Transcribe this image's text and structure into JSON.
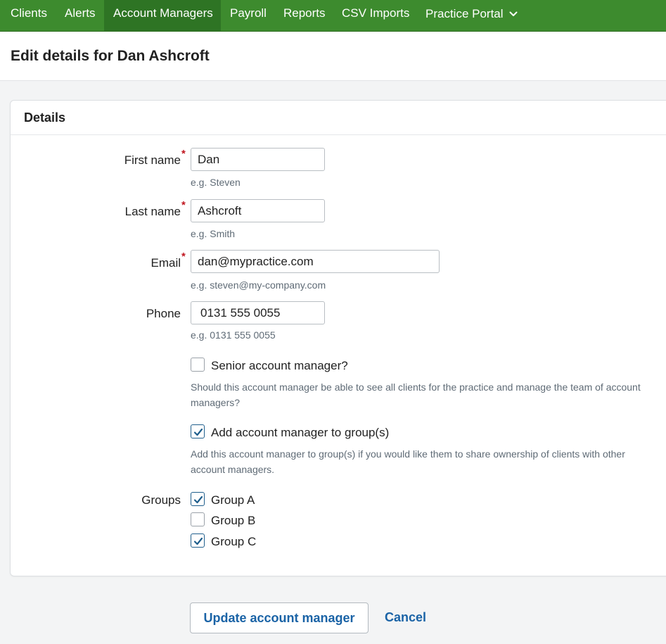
{
  "nav": {
    "items": [
      {
        "label": "Clients"
      },
      {
        "label": "Alerts"
      },
      {
        "label": "Account Managers",
        "active": true
      },
      {
        "label": "Payroll"
      },
      {
        "label": "Reports"
      },
      {
        "label": "CSV Imports"
      },
      {
        "label": "Practice Portal",
        "icon": "chevron-down-icon"
      }
    ],
    "background": "#3d8b2e"
  },
  "page": {
    "title": "Edit details for Dan Ashcroft"
  },
  "card": {
    "title": "Details"
  },
  "form": {
    "first_name": {
      "label": "First name",
      "value": "Dan",
      "hint": "e.g. Steven",
      "required": true
    },
    "last_name": {
      "label": "Last name",
      "value": "Ashcroft",
      "hint": "e.g. Smith",
      "required": true
    },
    "email": {
      "label": "Email",
      "value": "dan@mypractice.com",
      "hint": "e.g. steven@my-company.com",
      "required": true
    },
    "phone": {
      "label": "Phone",
      "value": "0131 555 0055",
      "hint": "e.g. 0131 555 0055",
      "required": false
    },
    "senior": {
      "label": "Senior account manager?",
      "checked": false,
      "help": "Should this account manager be able to see all clients for the practice and manage the team of account managers?"
    },
    "add_to_groups": {
      "label": "Add account manager to group(s)",
      "checked": true,
      "help": "Add this account manager to group(s) if you would like them to share ownership of clients with other account managers."
    },
    "groups": {
      "label": "Groups",
      "options": [
        {
          "label": "Group A",
          "checked": true
        },
        {
          "label": "Group B",
          "checked": false
        },
        {
          "label": "Group C",
          "checked": true
        }
      ]
    }
  },
  "actions": {
    "submit_label": "Update account manager",
    "cancel_label": "Cancel"
  },
  "colors": {
    "required": "#c0161f",
    "link": "#1a63a6",
    "checkbox": "#1f5e8c"
  }
}
